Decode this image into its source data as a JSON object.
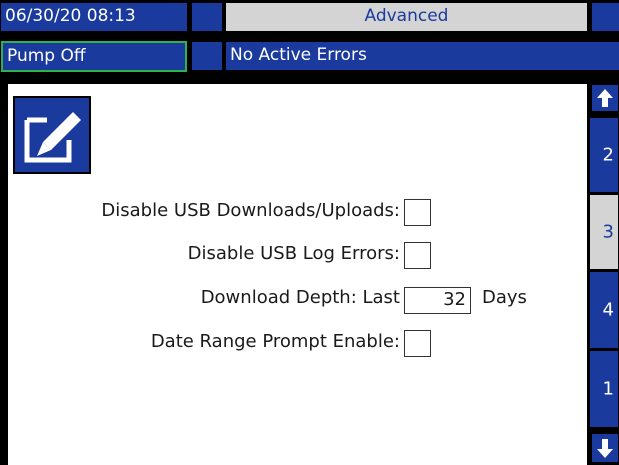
{
  "header": {
    "datetime": "06/30/20 08:13",
    "mode": "Advanced",
    "pump_status": "Pump Off",
    "error_status": "No Active Errors"
  },
  "icons": {
    "edit": "edit-icon",
    "up": "arrow-up-icon",
    "down": "arrow-down-icon"
  },
  "settings": {
    "usb_downloads_label": "Disable USB Downloads/Uploads:",
    "usb_downloads_checked": false,
    "usb_log_errors_label": "Disable USB Log Errors:",
    "usb_log_errors_checked": false,
    "download_depth_label": "Download Depth: Last",
    "download_depth_value": "32",
    "download_depth_unit": "Days",
    "date_range_label": "Date Range Prompt Enable:",
    "date_range_checked": false
  },
  "nav": {
    "tabs": [
      {
        "label": "2",
        "active": false
      },
      {
        "label": "3",
        "active": true
      },
      {
        "label": "4",
        "active": false
      },
      {
        "label": "1",
        "active": false
      }
    ]
  },
  "colors": {
    "primary_blue": "#1a3a9e",
    "inactive_gray": "#d4d4d4",
    "pump_border_green": "#2fb34a"
  }
}
